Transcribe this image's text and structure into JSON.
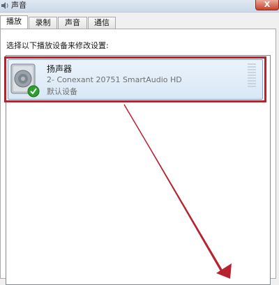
{
  "window": {
    "title": "声音",
    "close_label": "X"
  },
  "tabs": [
    {
      "label": "播放",
      "active": true
    },
    {
      "label": "录制",
      "active": false
    },
    {
      "label": "声音",
      "active": false
    },
    {
      "label": "通信",
      "active": false
    }
  ],
  "playback": {
    "instruction": "选择以下播放设备来修改设置:",
    "devices": [
      {
        "name": "扬声器",
        "description": "2- Conexant 20751 SmartAudio HD",
        "status": "默认设备",
        "icon": "speaker-icon",
        "badge_icon": "default-check-icon"
      }
    ]
  },
  "colors": {
    "highlight": "#b8222f",
    "selection": "#d9e8f6",
    "check": "#2e9e2e"
  }
}
